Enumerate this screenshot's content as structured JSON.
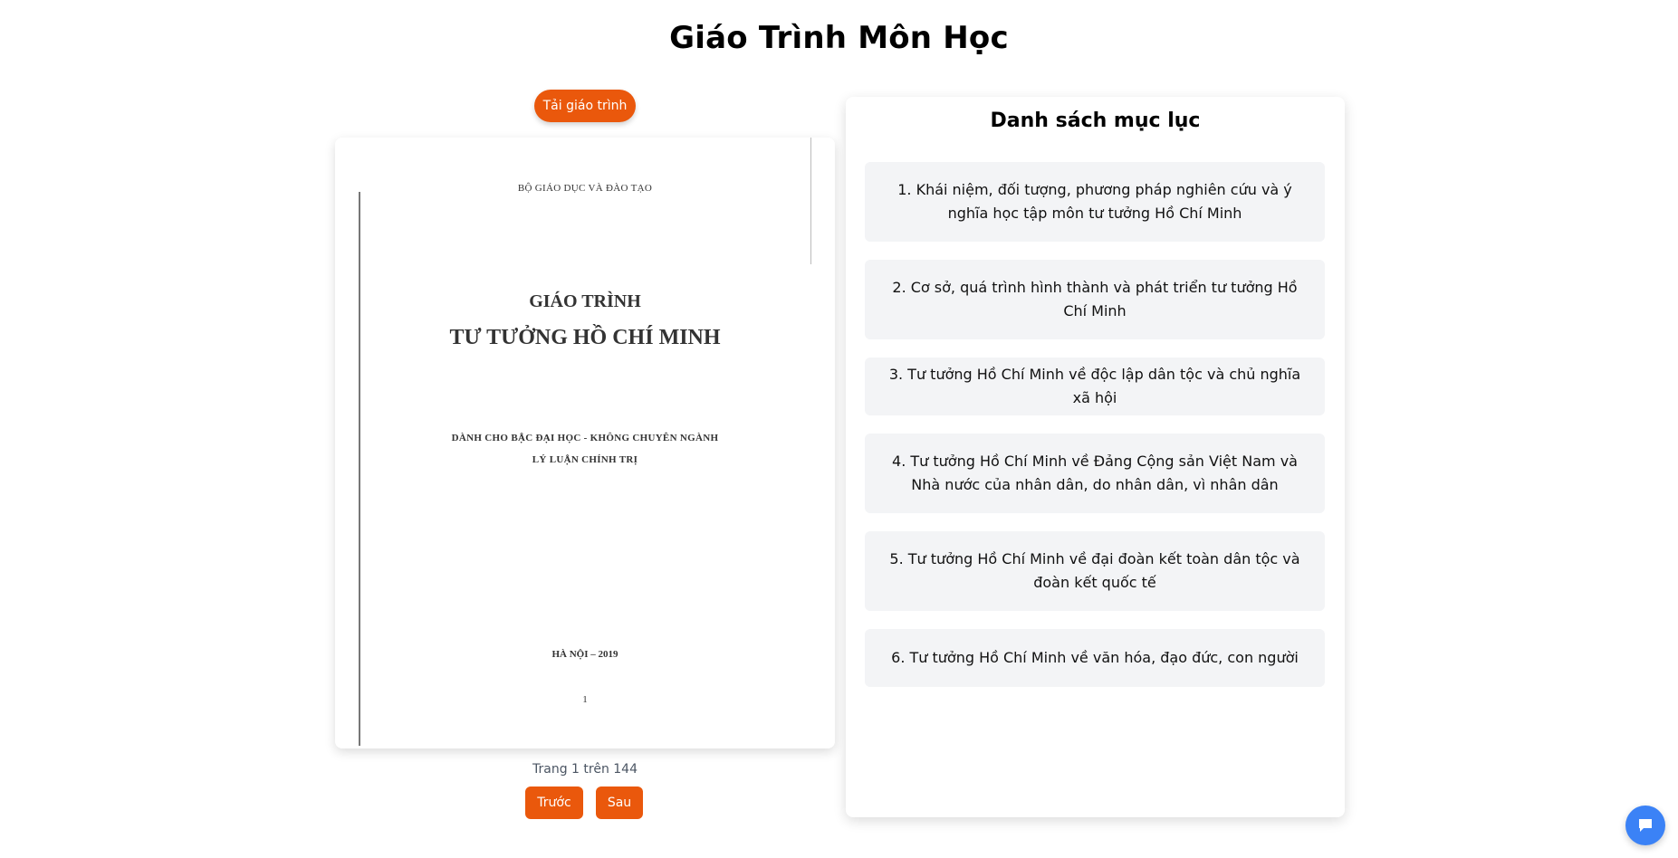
{
  "page": {
    "title": "Giáo Trình Môn Học"
  },
  "viewer": {
    "download_label": "Tải giáo trình",
    "document": {
      "ministry": "BỘ GIÁO DỤC VÀ ĐÀO TẠO",
      "title_line1": "GIÁO TRÌNH",
      "title_line2": "TƯ TƯỞNG HỒ CHÍ MINH",
      "subtitle_line1": "DÀNH CHO BẬC ĐẠI HỌC - KHÔNG CHUYÊN NGÀNH",
      "subtitle_line2": "LÝ LUẬN CHÍNH TRỊ",
      "city_year": "HÀ NỘI – 2019",
      "page_number": "1"
    },
    "page_indicator": "Trang 1 trên 144",
    "prev_label": "Trước",
    "next_label": "Sau"
  },
  "toc": {
    "title": "Danh sách mục lục",
    "items": [
      {
        "label": "1. Khái niệm, đối tượng, phương pháp nghiên cứu và ý nghĩa học tập môn tư tưởng Hồ Chí Minh"
      },
      {
        "label": "2. Cơ sở, quá trình hình thành và phát triển tư tưởng Hồ Chí Minh"
      },
      {
        "label": "3. Tư tưởng Hồ Chí Minh về độc lập dân tộc và chủ nghĩa xã hội"
      },
      {
        "label": "4. Tư tưởng Hồ Chí Minh về Đảng Cộng sản Việt Nam và Nhà nước của nhân dân, do nhân dân, vì nhân dân"
      },
      {
        "label": "5. Tư tưởng Hồ Chí Minh về đại đoàn kết toàn dân tộc và đoàn kết quốc tế"
      },
      {
        "label": "6. Tư tưởng Hồ Chí Minh về văn hóa, đạo đức, con người"
      }
    ]
  },
  "chat": {
    "icon": "chat-bubble-icon"
  },
  "colors": {
    "accent": "#ea580c",
    "toc_item_bg": "#f3f4f6",
    "chat": "#3b82f6"
  }
}
